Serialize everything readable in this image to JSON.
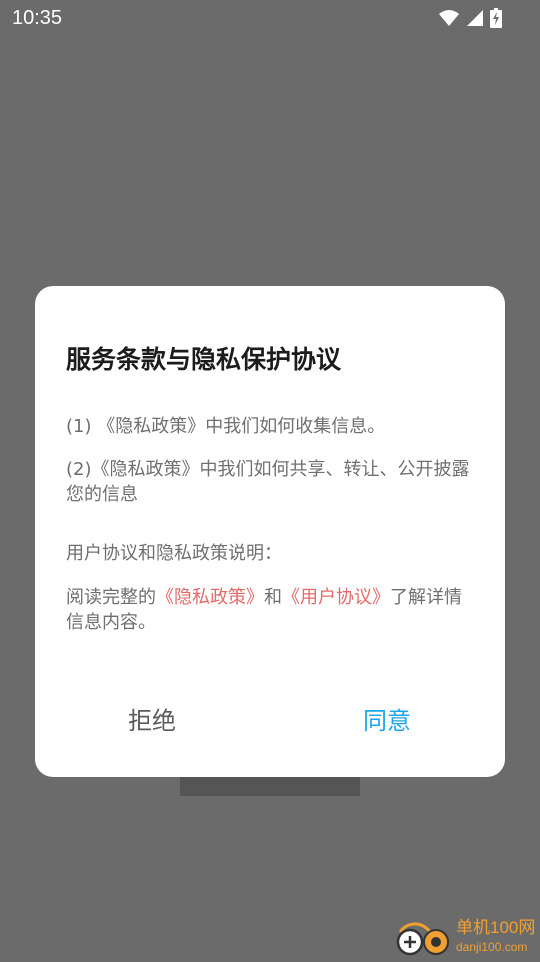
{
  "status_bar": {
    "time": "10:35",
    "icons": [
      "wifi-icon",
      "signal-icon",
      "battery-charging-icon"
    ]
  },
  "dialog": {
    "title": "服务条款与隐私保护协议",
    "item1": "(1) 《隐私政策》中我们如何收集信息。",
    "item2": "(2)《隐私政策》中我们如何共享、转让、公开披露您的信息",
    "section_label": "用户协议和隐私政策说明：",
    "read_prefix": "阅读完整的",
    "privacy_link": "《隐私政策》",
    "and": "和",
    "user_agreement_link": "《用户协议》",
    "read_suffix": "了解详情信息内容。",
    "reject_button": "拒绝",
    "agree_button": "同意"
  },
  "watermark": {
    "name": "单机100网",
    "domain": "danji100.com"
  },
  "colors": {
    "overlay": "#6b6b6b",
    "link": "#e36a6a",
    "agree": "#1ea7e8",
    "watermark": "#f0a030"
  }
}
